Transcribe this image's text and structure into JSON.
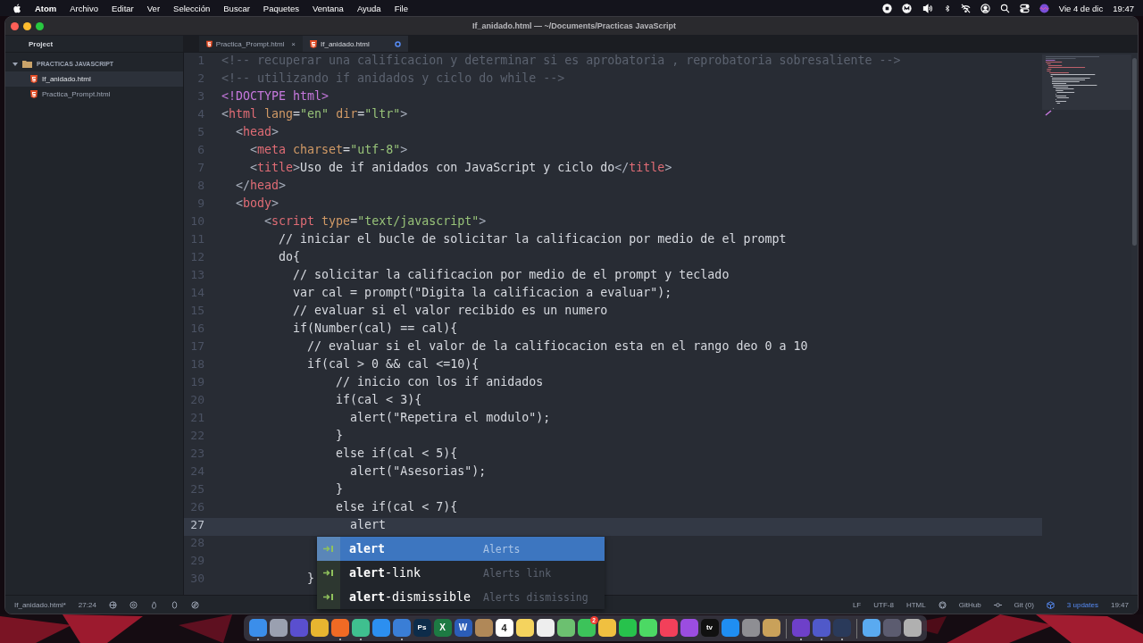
{
  "menu_bar": {
    "app": "Atom",
    "items": [
      "Archivo",
      "Editar",
      "Ver",
      "Selección",
      "Buscar",
      "Paquetes",
      "Ventana",
      "Ayuda",
      "File"
    ],
    "date": "Vie 4 de dic",
    "time": "19:47"
  },
  "window": {
    "title": "If_anidado.html — ~/Documents/Practicas JavaScript"
  },
  "sidebar": {
    "tab": "Project",
    "folder": {
      "name": "PRACTICAS JAVASCRIPT",
      "expanded": true,
      "children": [
        {
          "name": "If_anidado.html",
          "selected": true
        },
        {
          "name": "Practica_Prompt.html",
          "selected": false
        }
      ]
    }
  },
  "tabs": [
    {
      "label": "Practica_Prompt.html",
      "selected": false,
      "modified": false,
      "close": "×"
    },
    {
      "label": "If_anidado.html",
      "selected": true,
      "modified": true
    }
  ],
  "editor": {
    "lines": [
      {
        "number": "1",
        "current": false,
        "tokens": [
          {
            "kind": "comment",
            "text": "<!-- recuperar una calificacion y determinar si es aprobatoria , reprobatoria sobresaliente -->"
          }
        ]
      },
      {
        "number": "2",
        "current": false,
        "tokens": [
          {
            "kind": "comment",
            "text": "<!-- utilizando if anidados y ciclo do while -->"
          }
        ]
      },
      {
        "number": "3",
        "current": false,
        "tokens": [
          {
            "kind": "doctype",
            "text": "<!DOCTYPE html>"
          }
        ]
      },
      {
        "number": "4",
        "current": false,
        "tokens": [
          {
            "kind": "punct",
            "text": "<"
          },
          {
            "kind": "tag",
            "text": "html"
          },
          {
            "kind": "attr",
            "text": " lang"
          },
          {
            "kind": "text",
            "text": "="
          },
          {
            "kind": "string",
            "text": "\"en\""
          },
          {
            "kind": "attr",
            "text": " dir"
          },
          {
            "kind": "text",
            "text": "="
          },
          {
            "kind": "string",
            "text": "\"ltr\""
          },
          {
            "kind": "punct",
            "text": ">"
          }
        ]
      },
      {
        "number": "5",
        "current": false,
        "tokens": [
          {
            "kind": "punct",
            "text": "  <"
          },
          {
            "kind": "tag",
            "text": "head"
          },
          {
            "kind": "punct",
            "text": ">"
          }
        ]
      },
      {
        "number": "6",
        "current": false,
        "tokens": [
          {
            "kind": "punct",
            "text": "    <"
          },
          {
            "kind": "tag",
            "text": "meta"
          },
          {
            "kind": "attr",
            "text": " charset"
          },
          {
            "kind": "text",
            "text": "="
          },
          {
            "kind": "string",
            "text": "\"utf-8\""
          },
          {
            "kind": "punct",
            "text": ">"
          }
        ]
      },
      {
        "number": "7",
        "current": false,
        "tokens": [
          {
            "kind": "punct",
            "text": "    <"
          },
          {
            "kind": "tag",
            "text": "title"
          },
          {
            "kind": "punct",
            "text": ">"
          },
          {
            "kind": "text",
            "text": "Uso de if anidados con JavaScript y ciclo do"
          },
          {
            "kind": "punct",
            "text": "</"
          },
          {
            "kind": "tag",
            "text": "title"
          },
          {
            "kind": "punct",
            "text": ">"
          }
        ]
      },
      {
        "number": "8",
        "current": false,
        "tokens": [
          {
            "kind": "punct",
            "text": "  </"
          },
          {
            "kind": "tag",
            "text": "head"
          },
          {
            "kind": "punct",
            "text": ">"
          }
        ]
      },
      {
        "number": "9",
        "current": false,
        "tokens": [
          {
            "kind": "punct",
            "text": "  <"
          },
          {
            "kind": "tag",
            "text": "body"
          },
          {
            "kind": "punct",
            "text": ">"
          }
        ]
      },
      {
        "number": "10",
        "current": false,
        "tokens": [
          {
            "kind": "punct",
            "text": "      <"
          },
          {
            "kind": "tag",
            "text": "script"
          },
          {
            "kind": "attr",
            "text": " type"
          },
          {
            "kind": "text",
            "text": "="
          },
          {
            "kind": "string",
            "text": "\"text/javascript\""
          },
          {
            "kind": "punct",
            "text": ">"
          }
        ]
      },
      {
        "number": "11",
        "current": false,
        "tokens": [
          {
            "kind": "text",
            "text": "        // iniciar el bucle de solicitar la calificacion por medio de el prompt"
          }
        ]
      },
      {
        "number": "12",
        "current": false,
        "tokens": [
          {
            "kind": "text",
            "text": "        do{"
          }
        ]
      },
      {
        "number": "13",
        "current": false,
        "tokens": [
          {
            "kind": "text",
            "text": "          // solicitar la calificacion por medio de el prompt y teclado"
          }
        ]
      },
      {
        "number": "14",
        "current": false,
        "tokens": [
          {
            "kind": "text",
            "text": "          var cal = prompt(\"Digita la calificacion a evaluar\");"
          }
        ]
      },
      {
        "number": "15",
        "current": false,
        "tokens": [
          {
            "kind": "text",
            "text": "          // evaluar si el valor recibido es un numero"
          }
        ]
      },
      {
        "number": "16",
        "current": false,
        "tokens": [
          {
            "kind": "text",
            "text": "          if(Number(cal) == cal){"
          }
        ]
      },
      {
        "number": "17",
        "current": false,
        "tokens": [
          {
            "kind": "text",
            "text": "            // evaluar si el valor de la califiocacion esta en el rango deo 0 a 10"
          }
        ]
      },
      {
        "number": "18",
        "current": false,
        "tokens": [
          {
            "kind": "text",
            "text": "            if(cal > 0 && cal <=10){"
          }
        ]
      },
      {
        "number": "19",
        "current": false,
        "tokens": [
          {
            "kind": "text",
            "text": "                // inicio con los if anidados"
          }
        ]
      },
      {
        "number": "20",
        "current": false,
        "tokens": [
          {
            "kind": "text",
            "text": "                if(cal < 3){"
          }
        ]
      },
      {
        "number": "21",
        "current": false,
        "tokens": [
          {
            "kind": "text",
            "text": "                  alert(\"Repetira el modulo\");"
          }
        ]
      },
      {
        "number": "22",
        "current": false,
        "tokens": [
          {
            "kind": "text",
            "text": "                }"
          }
        ]
      },
      {
        "number": "23",
        "current": false,
        "tokens": [
          {
            "kind": "text",
            "text": "                else if(cal < 5){"
          }
        ]
      },
      {
        "number": "24",
        "current": false,
        "tokens": [
          {
            "kind": "text",
            "text": "                  alert(\"Asesorias\");"
          }
        ]
      },
      {
        "number": "25",
        "current": false,
        "tokens": [
          {
            "kind": "text",
            "text": "                }"
          }
        ]
      },
      {
        "number": "26",
        "current": false,
        "tokens": [
          {
            "kind": "text",
            "text": "                else if(cal < 7){"
          }
        ]
      },
      {
        "number": "27",
        "current": true,
        "tokens": [
          {
            "kind": "text",
            "text": "                  alert"
          }
        ]
      },
      {
        "number": "28",
        "current": false
      },
      {
        "number": "29",
        "current": false
      },
      {
        "number": "30",
        "current": false,
        "tokens": [
          {
            "kind": "text",
            "text": "            }"
          }
        ]
      }
    ]
  },
  "autocomplete": [
    {
      "text": "alert",
      "description": "Alerts",
      "selected": true
    },
    {
      "text": "**alert**-link",
      "description": "Alerts link",
      "selected": false
    },
    {
      "text": "**alert**-dismissible",
      "description": "Alerts dismissing",
      "selected": false
    }
  ],
  "status_bar": {
    "file": "If_anidado.html*",
    "cursor": "27:24",
    "line_ending": "LF",
    "encoding": "UTF-8",
    "grammar": "HTML",
    "github": "GitHub",
    "git": "Git (0)",
    "updates": "3 updates",
    "time": "19:47"
  },
  "dock": [
    {
      "kind": "app",
      "color": "#3b8eea",
      "running": true
    },
    {
      "kind": "app",
      "color": "#9aa0b0",
      "running": false
    },
    {
      "kind": "app",
      "color": "#5a4fcf",
      "running": false
    },
    {
      "kind": "app",
      "color": "#e8b530",
      "running": false
    },
    {
      "kind": "app",
      "color": "#f06a24",
      "running": true
    },
    {
      "kind": "app",
      "color": "#3fbf8f",
      "running": true
    },
    {
      "kind": "app",
      "color": "#2c8ff0",
      "running": false
    },
    {
      "kind": "app",
      "color": "#3a7ed6",
      "running": true
    },
    {
      "kind": "label",
      "label": "Ps",
      "color": "#0d2c4a",
      "running": false
    },
    {
      "kind": "label",
      "label": "X",
      "color": "#1d7a43",
      "running": false
    },
    {
      "kind": "label",
      "label": "W",
      "color": "#2b5db8",
      "running": false
    },
    {
      "kind": "app",
      "color": "#b08858",
      "running": false
    },
    {
      "kind": "calendar",
      "label": "4",
      "color": "#ffffff",
      "running": false
    },
    {
      "kind": "app",
      "color": "#f4d35e",
      "running": false
    },
    {
      "kind": "app",
      "color": "#eeeeee",
      "running": false
    },
    {
      "kind": "app",
      "color": "#6cc070",
      "running": false
    },
    {
      "kind": "badge",
      "badge": "2",
      "color": "#3cc35a",
      "running": false
    },
    {
      "kind": "app",
      "color": "#f0c040",
      "running": false
    },
    {
      "kind": "app",
      "color": "#27c24c",
      "running": false
    },
    {
      "kind": "app",
      "color": "#4cd964",
      "running": false
    },
    {
      "kind": "app",
      "color": "#f2405a",
      "running": false
    },
    {
      "kind": "app",
      "color": "#9b4de0",
      "running": false
    },
    {
      "kind": "label",
      "label": "tv",
      "color": "#111111",
      "running": false
    },
    {
      "kind": "app",
      "color": "#1f8ef2",
      "running": false
    },
    {
      "kind": "app",
      "color": "#8e8e93",
      "running": false
    },
    {
      "kind": "app",
      "color": "#c9a15a",
      "running": false
    },
    {
      "kind": "separator"
    },
    {
      "kind": "app",
      "color": "#6e40c9",
      "running": true
    },
    {
      "kind": "app",
      "color": "#5059c9",
      "running": true
    },
    {
      "kind": "app",
      "color": "#2a3a5a",
      "running": true
    },
    {
      "kind": "separator"
    },
    {
      "kind": "app",
      "color": "#5aaaf0",
      "running": false
    },
    {
      "kind": "app",
      "color": "#5c5c70",
      "running": false
    },
    {
      "kind": "app",
      "color": "#b0b0b0",
      "running": false
    }
  ]
}
